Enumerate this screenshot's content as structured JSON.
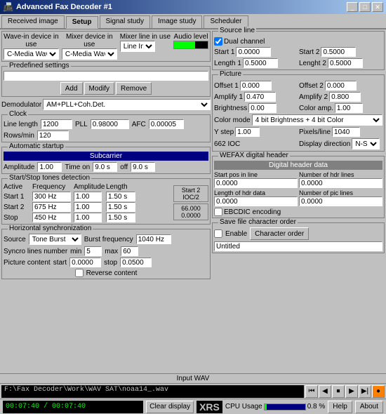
{
  "window": {
    "title": "Advanced Fax Decoder #1",
    "icon": "📠"
  },
  "tabs": [
    {
      "label": "Received image",
      "active": false
    },
    {
      "label": "Setup",
      "active": true
    },
    {
      "label": "Signal study",
      "active": false
    },
    {
      "label": "Image study",
      "active": false
    },
    {
      "label": "Scheduler",
      "active": false
    }
  ],
  "devices": {
    "wave_in_label": "Wave-in device in use",
    "mixer_device_label": "Mixer device in use",
    "mixer_line_label": "Mixer line in use",
    "audio_level_label": "Audio level",
    "wave_in_value": "C-Media Wave Device",
    "mixer_device_value": "C-Media Wave Device",
    "mixer_line_value": "Line In"
  },
  "predefined": {
    "title": "Predefined settings",
    "add_label": "Add",
    "modify_label": "Modify",
    "remove_label": "Remove"
  },
  "demodulator": {
    "label": "Demodulator",
    "value": "AM+PLL+Coh.Det."
  },
  "clock": {
    "title": "Clock",
    "line_length_label": "Line length",
    "line_length_value": "1200",
    "pll_label": "PLL",
    "pll_value": "0.98000",
    "afc_label": "AFC",
    "afc_value": "0.00005",
    "rows_min_label": "Rows/min",
    "rows_min_value": "120"
  },
  "auto_startup": {
    "title": "Automatic startup",
    "subcarrier_title": "Subcarrier",
    "amplitude_label": "Amplitude",
    "amplitude_value": "1.00",
    "time_on_label": "Time on",
    "time_on_value": "9.0 s",
    "off_label": "off",
    "off_value": "9.0 s"
  },
  "tones": {
    "title": "Start/Stop tones detection",
    "headers": [
      "Active",
      "Frequency",
      "Amplitude",
      "Length"
    ],
    "rows": [
      {
        "label": "Start 1",
        "freq": "300 Hz",
        "amp": "1.00",
        "len": "1.50 s"
      },
      {
        "label": "Start 2",
        "freq": "675 Hz",
        "amp": "1.00",
        "len": "1.50 s"
      },
      {
        "label": "Stop",
        "freq": "450 Hz",
        "amp": "1.00",
        "len": "1.50 s"
      }
    ],
    "overlay1": "Start 2\nIOC/2",
    "overlay2": "66.000\n0.0000"
  },
  "horiz_sync": {
    "title": "Horizontal synchronization",
    "source_label": "Source",
    "source_value": "Tone Burst",
    "burst_freq_label": "Burst frequency",
    "burst_freq_value": "1040 Hz",
    "sync_lines_label": "Syncro lines number",
    "min_label": "min",
    "min_value": "5",
    "max_label": "max",
    "max_value": "60",
    "picture_content_label": "Picture content",
    "start_label": "start",
    "start_value": "0.0000",
    "stop_label": "stop",
    "stop_value": "0.0500",
    "reverse_label": "Reverse content"
  },
  "source_line": {
    "title": "Source line",
    "dual_channel_label": "Dual channel",
    "start1_label": "Start 1",
    "start1_value": "0.0000",
    "start2_label": "Start 2",
    "start2_value": "0.5000",
    "length1_label": "Length 1",
    "length1_value": "0.5000",
    "length2_label": "Lenght 2",
    "length2_value": "0.5000"
  },
  "picture": {
    "title": "Picture",
    "offset1_label": "Offset 1",
    "offset1_value": "0.000",
    "offset2_label": "Offset 2",
    "offset2_value": "0.000",
    "amplify1_label": "Amplify 1",
    "amplify1_value": "0.470",
    "amplify2_label": "Amplify 2",
    "amplify2_value": "0.800",
    "brightness_label": "Brightness",
    "brightness_value": "0.00",
    "color_amp_label": "Color amp.",
    "color_amp_value": "1.00",
    "color_mode_label": "Color mode",
    "color_mode_value": "4 bit Brightness + 4 bit Color",
    "y_step_label": "Y step",
    "y_step_value": "1.00",
    "pixels_line_label": "Pixels/line",
    "pixels_line_value": "1040",
    "ioc_label": "662 IOC",
    "display_dir_label": "Display direction",
    "display_dir_value": "N-S"
  },
  "wefax_header": {
    "title": "WEFAX digital header",
    "digital_header_title": "Digital header data",
    "start_pos_label": "Start pos in line",
    "start_pos_value": "0.0000",
    "num_hdr_label": "Number of hdr lines",
    "num_hdr_value": "0.0000",
    "length_hdr_label": "Length of hdr data",
    "length_hdr_value": "0.0000",
    "num_pic_label": "Number of pic lines",
    "num_pic_value": "0.0000",
    "ebcdic_label": "EBCDIC encoding"
  },
  "save_file": {
    "title": "Save file character order",
    "enable_label": "Enable",
    "char_order_label": "Character order",
    "filename": "Untitled"
  },
  "bottom": {
    "wav_section": "Input WAV",
    "wav_path": "F:\\Fax Decoder\\Work\\WAV SAT\\noaa14_.wav",
    "clear_display_label": "Clear display",
    "xrs_label": "XRS",
    "cpu_label": "CPU Usage",
    "cpu_value": "0.8 %",
    "time_current": "00:07:40",
    "time_total": "00:07:40",
    "help_label": "Help",
    "about_label": "About"
  }
}
